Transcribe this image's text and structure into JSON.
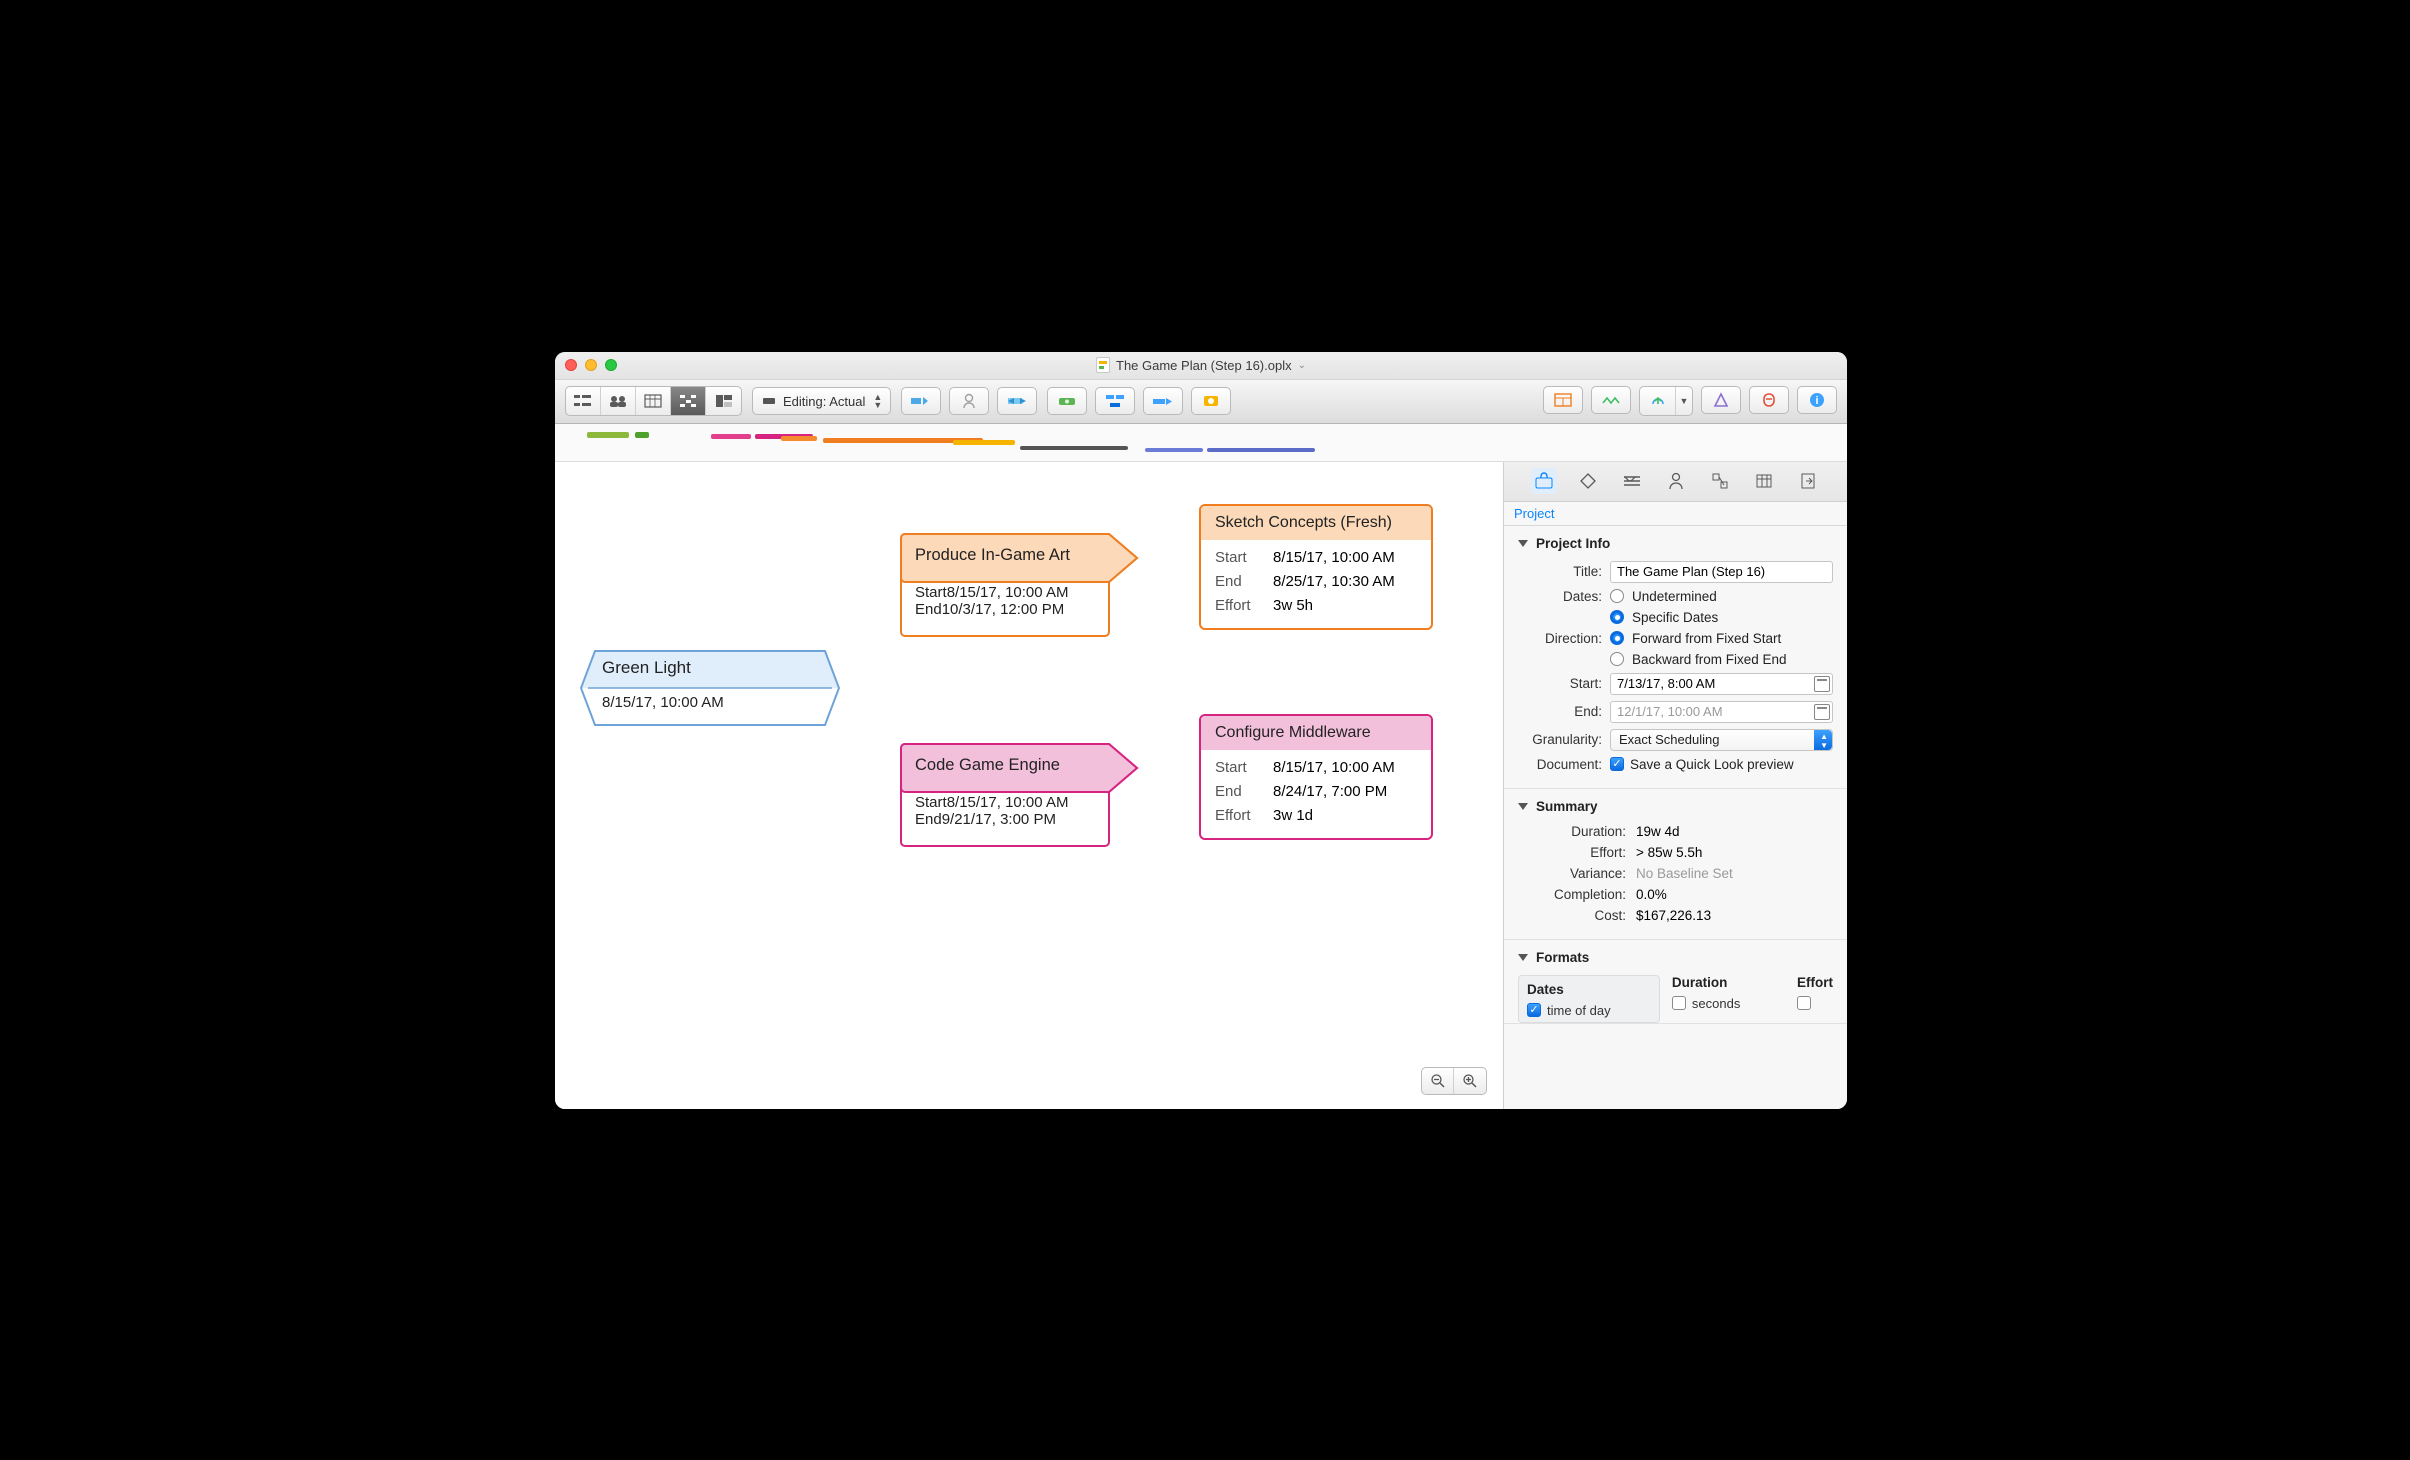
{
  "window": {
    "title": "The Game Plan (Step 16).oplx",
    "caret": "⌄"
  },
  "toolbar": {
    "editing_label": "Editing: Actual"
  },
  "canvas": {
    "field_labels": {
      "start": "Start",
      "end": "End",
      "effort": "Effort"
    },
    "milestone": {
      "title": "Green Light",
      "date": "8/15/17, 10:00 AM"
    },
    "nodes": {
      "art": {
        "title": "Produce In-Game Art",
        "start": "8/15/17, 10:00 AM",
        "end": "10/3/17, 12:00 PM"
      },
      "sketch": {
        "title": "Sketch Concepts (Fresh)",
        "start": "8/15/17, 10:00 AM",
        "end": "8/25/17, 10:30 AM",
        "effort": "3w 5h"
      },
      "engine": {
        "title": "Code Game Engine",
        "start": "8/15/17, 10:00 AM",
        "end": "9/21/17, 3:00 PM"
      },
      "middleware": {
        "title": "Configure Middleware",
        "start": "8/15/17, 10:00 AM",
        "end": "8/24/17, 7:00 PM",
        "effort": "3w 1d"
      }
    }
  },
  "inspector": {
    "tab_label": "Project",
    "sections": {
      "project_info": {
        "heading": "Project Info",
        "title_label": "Title:",
        "title_value": "The Game Plan (Step 16)",
        "dates_label": "Dates:",
        "dates_opt_undetermined": "Undetermined",
        "dates_opt_specific": "Specific Dates",
        "direction_label": "Direction:",
        "direction_forward": "Forward from Fixed Start",
        "direction_backward": "Backward from Fixed End",
        "start_label": "Start:",
        "start_value": "7/13/17, 8:00 AM",
        "end_label": "End:",
        "end_value": "12/1/17, 10:00 AM",
        "granularity_label": "Granularity:",
        "granularity_value": "Exact Scheduling",
        "document_label": "Document:",
        "quicklook_label": "Save a Quick Look preview"
      },
      "summary": {
        "heading": "Summary",
        "duration_label": "Duration:",
        "duration_value": "19w 4d",
        "effort_label": "Effort:",
        "effort_value": "> 85w 5.5h",
        "variance_label": "Variance:",
        "variance_value": "No Baseline Set",
        "completion_label": "Completion:",
        "completion_value": "0.0%",
        "cost_label": "Cost:",
        "cost_value": "$167,226.13"
      },
      "formats": {
        "heading": "Formats",
        "dates_col": "Dates",
        "dates_row": "time of day",
        "duration_col": "Duration",
        "effort_col": "Effort",
        "seconds_row": "seconds"
      }
    }
  }
}
